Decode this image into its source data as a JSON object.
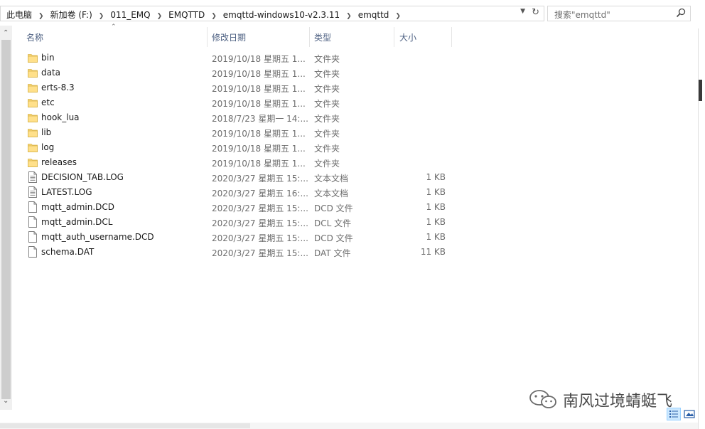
{
  "address": {
    "crumbs": [
      "此电脑",
      "新加卷 (F:)",
      "011_EMQ",
      "EMQTTD",
      "emqttd-windows10-v2.3.11",
      "emqttd"
    ]
  },
  "search": {
    "placeholder": "搜索\"emqttd\""
  },
  "columns": {
    "name": "名称",
    "date": "修改日期",
    "type": "类型",
    "size": "大小"
  },
  "files": [
    {
      "name": "bin",
      "date": "2019/10/18 星期五 1...",
      "type": "文件夹",
      "size": "",
      "icon": "folder-icon"
    },
    {
      "name": "data",
      "date": "2019/10/18 星期五 1...",
      "type": "文件夹",
      "size": "",
      "icon": "folder-icon"
    },
    {
      "name": "erts-8.3",
      "date": "2019/10/18 星期五 1...",
      "type": "文件夹",
      "size": "",
      "icon": "folder-icon"
    },
    {
      "name": "etc",
      "date": "2019/10/18 星期五 1...",
      "type": "文件夹",
      "size": "",
      "icon": "folder-icon"
    },
    {
      "name": "hook_lua",
      "date": "2018/7/23 星期一 14:...",
      "type": "文件夹",
      "size": "",
      "icon": "folder-icon"
    },
    {
      "name": "lib",
      "date": "2019/10/18 星期五 1...",
      "type": "文件夹",
      "size": "",
      "icon": "folder-icon"
    },
    {
      "name": "log",
      "date": "2019/10/18 星期五 1...",
      "type": "文件夹",
      "size": "",
      "icon": "folder-icon"
    },
    {
      "name": "releases",
      "date": "2019/10/18 星期五 1...",
      "type": "文件夹",
      "size": "",
      "icon": "folder-icon"
    },
    {
      "name": "DECISION_TAB.LOG",
      "date": "2020/3/27 星期五 15:...",
      "type": "文本文档",
      "size": "1 KB",
      "icon": "text-file-icon"
    },
    {
      "name": "LATEST.LOG",
      "date": "2020/3/27 星期五 16:...",
      "type": "文本文档",
      "size": "1 KB",
      "icon": "text-file-icon"
    },
    {
      "name": "mqtt_admin.DCD",
      "date": "2020/3/27 星期五 15:...",
      "type": "DCD 文件",
      "size": "1 KB",
      "icon": "file-icon"
    },
    {
      "name": "mqtt_admin.DCL",
      "date": "2020/3/27 星期五 15:...",
      "type": "DCL 文件",
      "size": "1 KB",
      "icon": "file-icon"
    },
    {
      "name": "mqtt_auth_username.DCD",
      "date": "2020/3/27 星期五 15:...",
      "type": "DCD 文件",
      "size": "1 KB",
      "icon": "file-icon"
    },
    {
      "name": "schema.DAT",
      "date": "2020/3/27 星期五 15:...",
      "type": "DAT 文件",
      "size": "11 KB",
      "icon": "file-icon"
    }
  ],
  "watermark": {
    "text": "南风过境蜻蜓飞"
  }
}
